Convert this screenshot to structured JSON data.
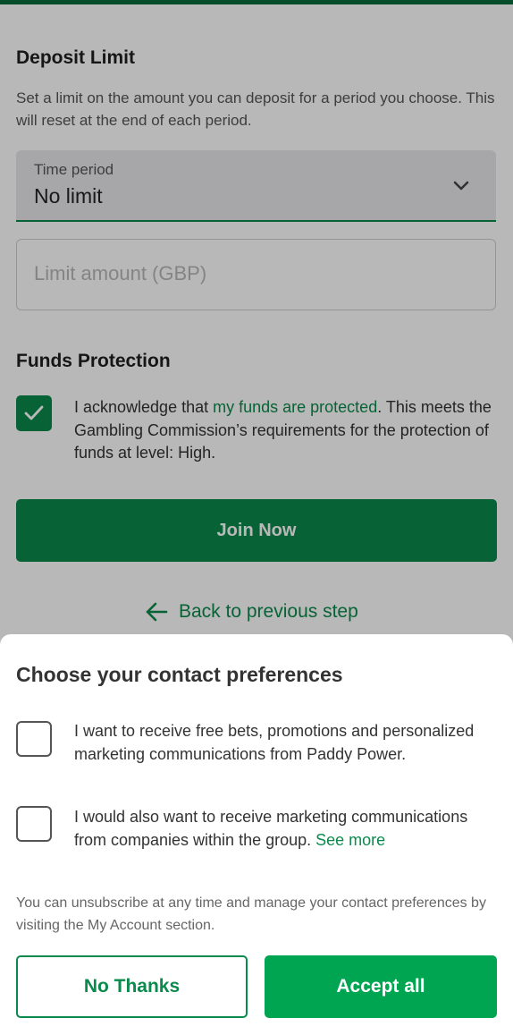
{
  "deposit": {
    "title": "Deposit Limit",
    "description": "Set a limit on the amount you can deposit for a period you choose. This will reset at the end of each period.",
    "time_period_label": "Time period",
    "time_period_value": "No limit",
    "limit_amount_placeholder": "Limit amount (GBP)"
  },
  "funds": {
    "title": "Funds Protection",
    "ack_prefix": "I acknowledge that ",
    "ack_link": "my funds are protected",
    "ack_suffix": ". This meets the Gambling Commission’s requirements for the protection of funds at level: High.",
    "checked": true
  },
  "actions": {
    "join_label": "Join Now",
    "back_label": "Back to previous step"
  },
  "contact_sheet": {
    "title": "Choose your contact preferences",
    "option1": "I want to receive free bets, promotions and personalized marketing communications from Paddy Power.",
    "option2_text": "I would also want to receive marketing communications from companies within the group. ",
    "option2_link": "See more",
    "note": "You can unsubscribe at any time and manage your contact preferences by visiting the My Account section.",
    "no_thanks_label": "No Thanks",
    "accept_label": "Accept all"
  },
  "colors": {
    "brand_green": "#0a8a4c",
    "accept_green": "#00a551",
    "top_bar": "#0a6b3d"
  },
  "icons": {
    "dropdown": "chevron-down-icon",
    "check": "checkmark-icon",
    "back": "arrow-left-icon"
  }
}
